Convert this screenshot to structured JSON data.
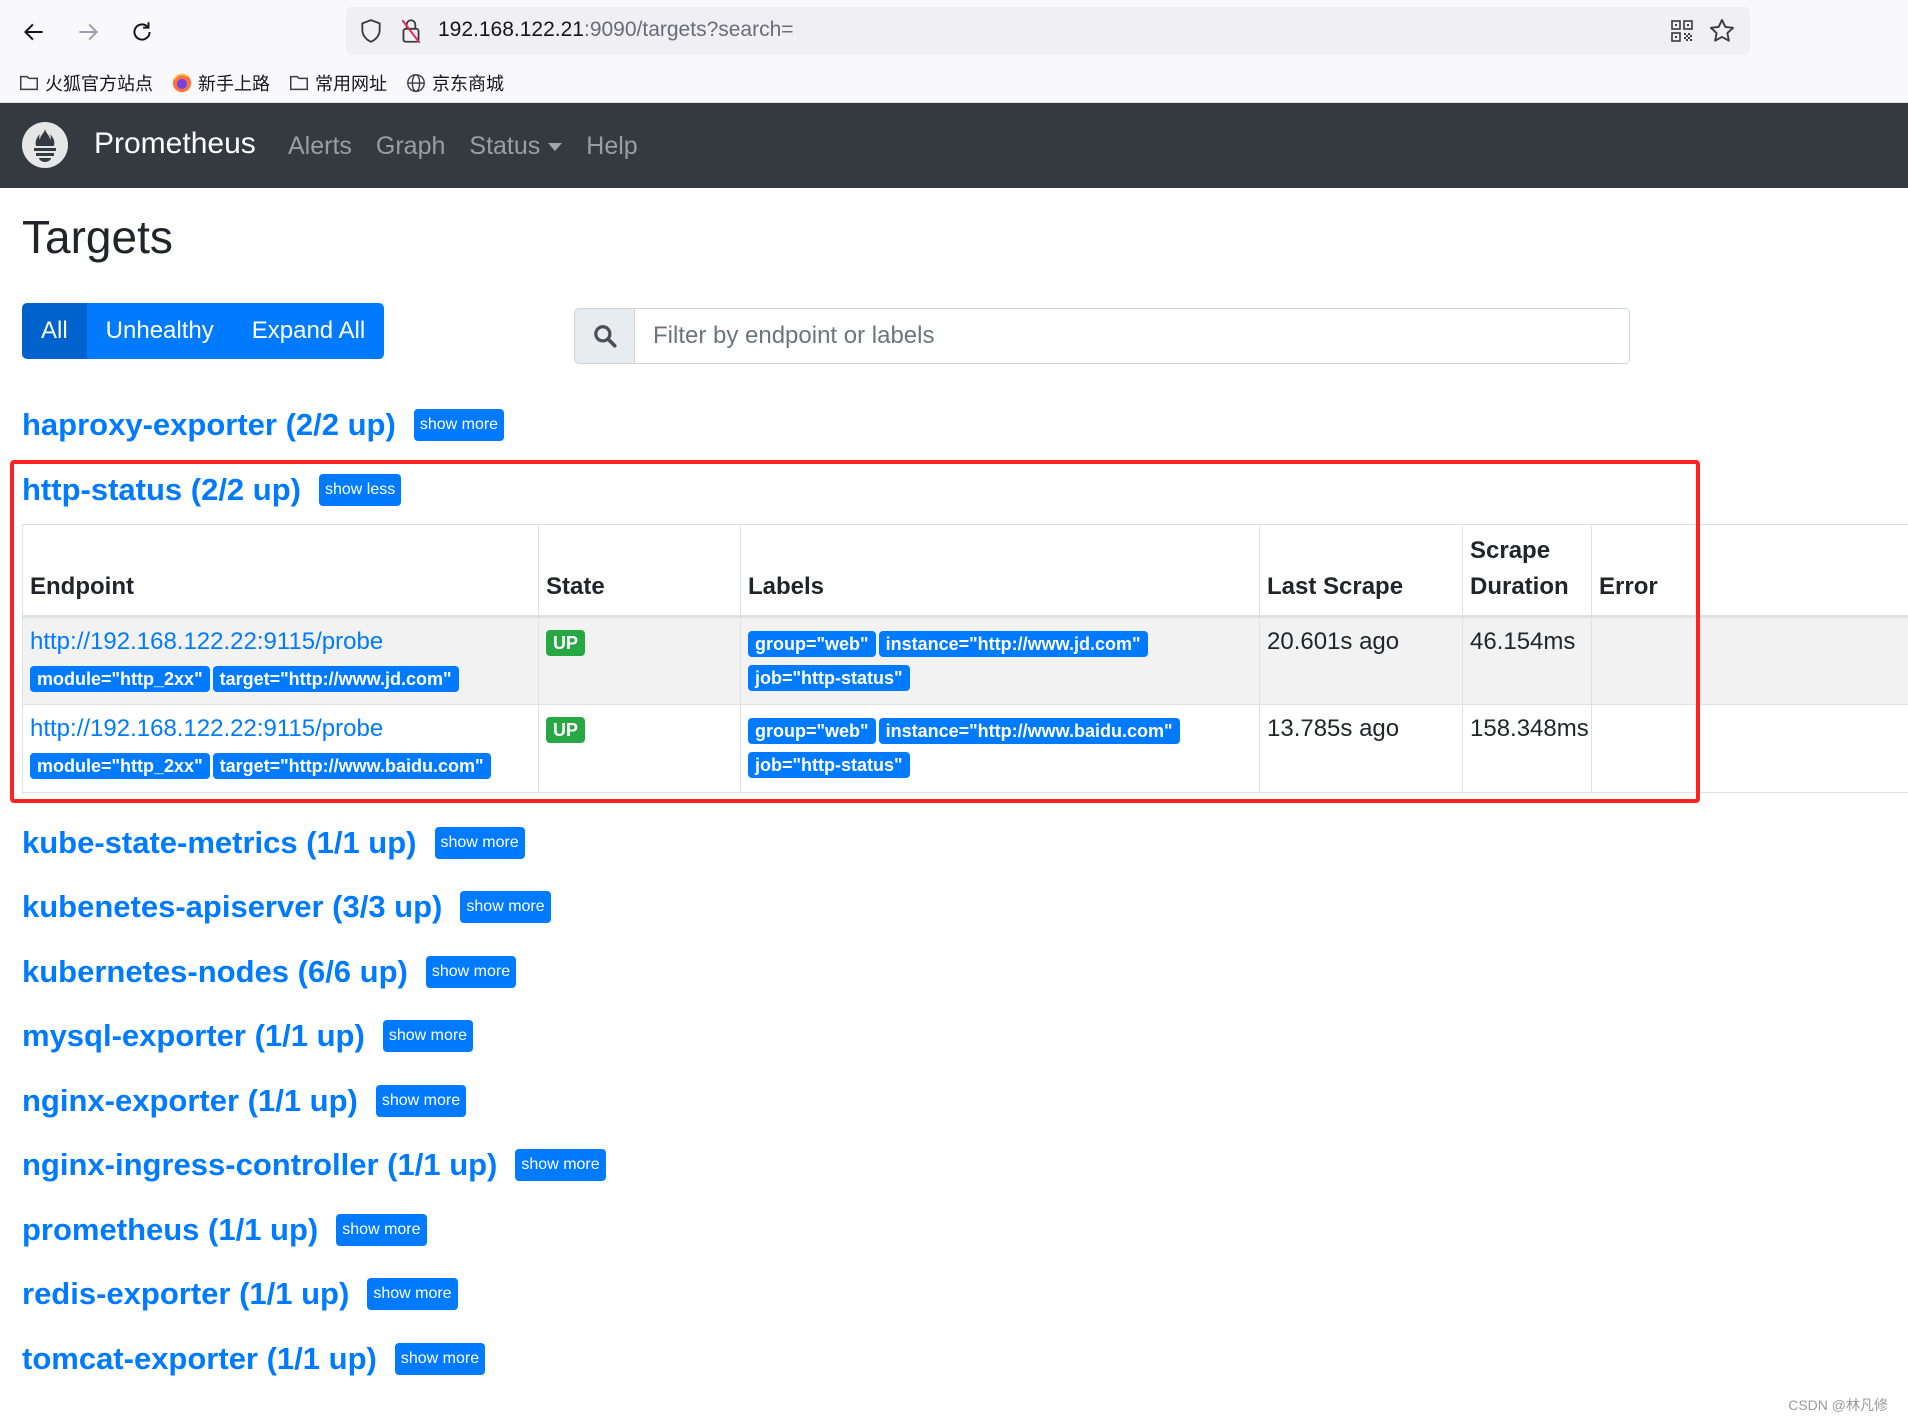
{
  "browser": {
    "url_host": "192.168.122.21",
    "url_rest": ":9090/targets?search=",
    "bookmarks": [
      {
        "label": "火狐官方站点",
        "icon": "folder-icon"
      },
      {
        "label": "新手上路",
        "icon": "firefox-icon"
      },
      {
        "label": "常用网址",
        "icon": "folder-icon"
      },
      {
        "label": "京东商城",
        "icon": "globe-icon"
      }
    ]
  },
  "navbar": {
    "brand": "Prometheus",
    "links": [
      "Alerts",
      "Graph",
      "Status",
      "Help"
    ]
  },
  "page": {
    "title": "Targets",
    "filters": {
      "all": "All",
      "unhealthy": "Unhealthy",
      "expand_all": "Expand All"
    },
    "search_placeholder": "Filter by endpoint or labels"
  },
  "jobs": [
    {
      "title": "haproxy-exporter (2/2 up)",
      "toggle": "show more"
    },
    {
      "title": "http-status (2/2 up)",
      "toggle": "show less"
    },
    {
      "title": "kube-state-metrics (1/1 up)",
      "toggle": "show more"
    },
    {
      "title": "kubenetes-apiserver (3/3 up)",
      "toggle": "show more"
    },
    {
      "title": "kubernetes-nodes (6/6 up)",
      "toggle": "show more"
    },
    {
      "title": "mysql-exporter (1/1 up)",
      "toggle": "show more"
    },
    {
      "title": "nginx-exporter (1/1 up)",
      "toggle": "show more"
    },
    {
      "title": "nginx-ingress-controller (1/1 up)",
      "toggle": "show more"
    },
    {
      "title": "prometheus (1/1 up)",
      "toggle": "show more"
    },
    {
      "title": "redis-exporter (1/1 up)",
      "toggle": "show more"
    },
    {
      "title": "tomcat-exporter (1/1 up)",
      "toggle": "show more"
    }
  ],
  "table": {
    "headers": {
      "endpoint": "Endpoint",
      "state": "State",
      "labels": "Labels",
      "last_scrape": "Last Scrape",
      "scrape_duration_1": "Scrape",
      "scrape_duration_2": "Duration",
      "error": "Error"
    },
    "rows": [
      {
        "endpoint": "http://192.168.122.22:9115/probe",
        "params": [
          "module=\"http_2xx\"",
          "target=\"http://www.jd.com\""
        ],
        "state": "UP",
        "labels": [
          "group=\"web\"",
          "instance=\"http://www.jd.com\"",
          "job=\"http-status\""
        ],
        "last_scrape": "20.601s ago",
        "scrape_duration": "46.154ms",
        "error": ""
      },
      {
        "endpoint": "http://192.168.122.22:9115/probe",
        "params": [
          "module=\"http_2xx\"",
          "target=\"http://www.baidu.com\""
        ],
        "state": "UP",
        "labels": [
          "group=\"web\"",
          "instance=\"http://www.baidu.com\"",
          "job=\"http-status\""
        ],
        "last_scrape": "13.785s ago",
        "scrape_duration": "158.348ms",
        "error": ""
      }
    ]
  },
  "colors": {
    "primary": "#007bff",
    "primary_active": "#0062cc",
    "success": "#28a745",
    "navbar": "#343a40",
    "annotation": "#ff2222"
  },
  "watermark": "CSDN @林凡修"
}
